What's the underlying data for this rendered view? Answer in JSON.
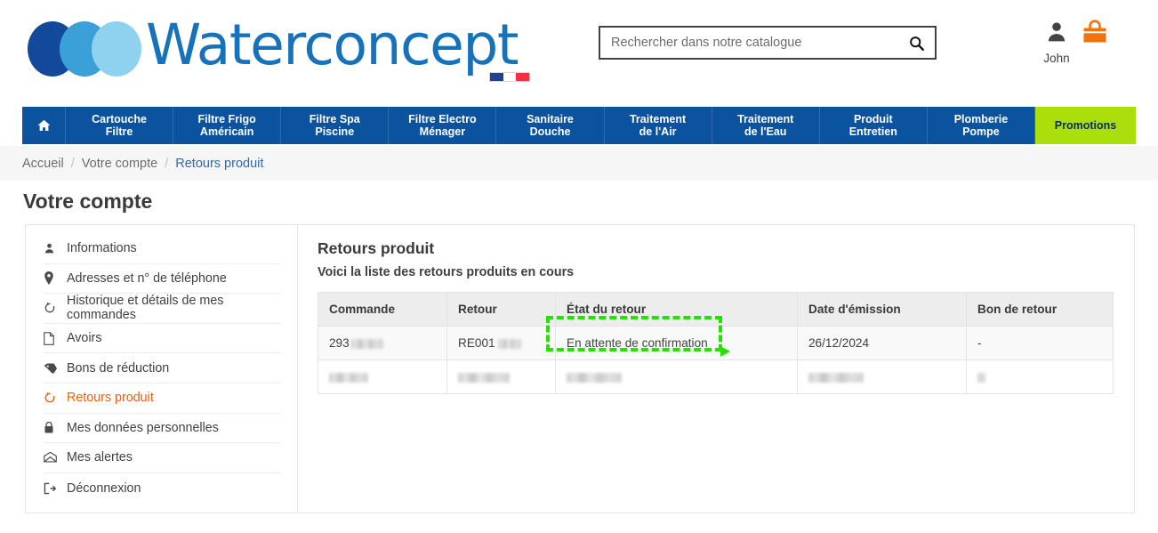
{
  "header": {
    "brand": "Waterconcept",
    "flag_colors": [
      "#23408e",
      "#ffffff",
      "#ef3340"
    ],
    "search": {
      "placeholder": "Rechercher dans notre catalogue",
      "value": "",
      "button_icon": "search-icon"
    },
    "user": {
      "icon": "user-icon",
      "name": "John"
    },
    "cart": {
      "icon": "shopping-bag-icon"
    }
  },
  "nav": {
    "home_icon": "home-icon",
    "items": [
      {
        "label": "Cartouche\nFiltre",
        "highlight": false
      },
      {
        "label": "Filtre Frigo\nAméricain",
        "highlight": false
      },
      {
        "label": "Filtre Spa\nPiscine",
        "highlight": false
      },
      {
        "label": "Filtre Electro\nMénager",
        "highlight": false
      },
      {
        "label": "Sanitaire\nDouche",
        "highlight": false
      },
      {
        "label": "Traitement\nde l'Air",
        "highlight": false
      },
      {
        "label": "Traitement\nde l'Eau",
        "highlight": false
      },
      {
        "label": "Produit\nEntretien",
        "highlight": false
      },
      {
        "label": "Plomberie\nPompe",
        "highlight": false
      },
      {
        "label": "Promotions",
        "highlight": true
      }
    ],
    "bar_color": "#0b539f",
    "promo_color": "#abdf0c"
  },
  "breadcrumb": {
    "items": [
      "Accueil",
      "Votre compte",
      "Retours produit"
    ],
    "separator": "/",
    "current_color": "#2c69b2"
  },
  "page": {
    "title": "Votre compte"
  },
  "sidebar": {
    "items": [
      {
        "label": "Informations",
        "icon": "user-icon",
        "active": false
      },
      {
        "label": "Adresses et n° de téléphone",
        "icon": "map-pin-icon",
        "active": false
      },
      {
        "label": "Historique et détails de mes commandes",
        "icon": "history-icon",
        "active": false
      },
      {
        "label": "Avoirs",
        "icon": "file-icon",
        "active": false
      },
      {
        "label": "Bons de réduction",
        "icon": "tag-icon",
        "active": false
      },
      {
        "label": "Retours produit",
        "icon": "return-arrow-icon",
        "active": true
      },
      {
        "label": "Mes données personnelles",
        "icon": "lock-icon",
        "active": false
      },
      {
        "label": "Mes alertes",
        "icon": "envelope-icon",
        "active": false
      },
      {
        "label": "Déconnexion",
        "icon": "logout-icon",
        "active": false
      }
    ],
    "active_color": "#f0600f"
  },
  "main": {
    "title": "Retours produit",
    "subtitle": "Voici la liste des retours produits en cours",
    "table": {
      "columns": [
        "Commande",
        "Retour",
        "État du retour",
        "Date d'émission",
        "Bon de retour"
      ],
      "rows": [
        {
          "commande": "293",
          "commande_redacted": true,
          "retour": "RE001",
          "retour_redacted": true,
          "etat": "En attente de confirmation",
          "date": "26/12/2024",
          "bon": "-",
          "redacted": false
        },
        {
          "commande": "",
          "commande_redacted": true,
          "retour": "",
          "retour_redacted": true,
          "etat": "",
          "date": "",
          "bon": "",
          "redacted": true
        }
      ]
    }
  },
  "annotation": {
    "target_text": "En attente de confirmation",
    "color": "#27e000",
    "style": "dashed-rectangle-with-arrow"
  }
}
